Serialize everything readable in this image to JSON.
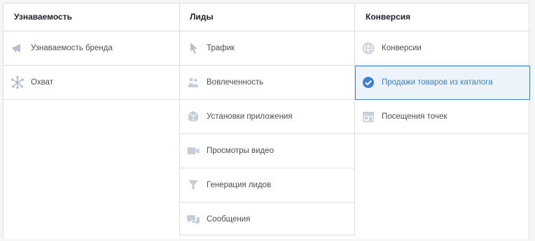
{
  "colors": {
    "accent": "#4080d0",
    "selected_bg": "#ecf3fb",
    "border": "#dddfe2",
    "icon": "#b8c0cc",
    "text": "#4b4f56",
    "heading": "#1d2129"
  },
  "columns": [
    {
      "heading": "Узнаваемость",
      "items": [
        {
          "label": "Узнаваемость бренда",
          "icon": "megaphone-icon"
        },
        {
          "label": "Охват",
          "icon": "reach-icon"
        }
      ]
    },
    {
      "heading": "Лиды",
      "items": [
        {
          "label": "Трафик",
          "icon": "cursor-icon"
        },
        {
          "label": "Вовлеченность",
          "icon": "people-icon"
        },
        {
          "label": "Установки приложения",
          "icon": "box-icon"
        },
        {
          "label": "Просмотры видео",
          "icon": "video-camera-icon"
        },
        {
          "label": "Генерация лидов",
          "icon": "funnel-icon"
        },
        {
          "label": "Сообщения",
          "icon": "chat-bubbles-icon"
        }
      ]
    },
    {
      "heading": "Конверсия",
      "items": [
        {
          "label": "Конверсии",
          "icon": "globe-icon"
        },
        {
          "label": "Продажи товаров из каталога",
          "icon": "check-circle-icon",
          "selected": true
        },
        {
          "label": "Посещения точек",
          "icon": "store-icon"
        }
      ]
    }
  ]
}
